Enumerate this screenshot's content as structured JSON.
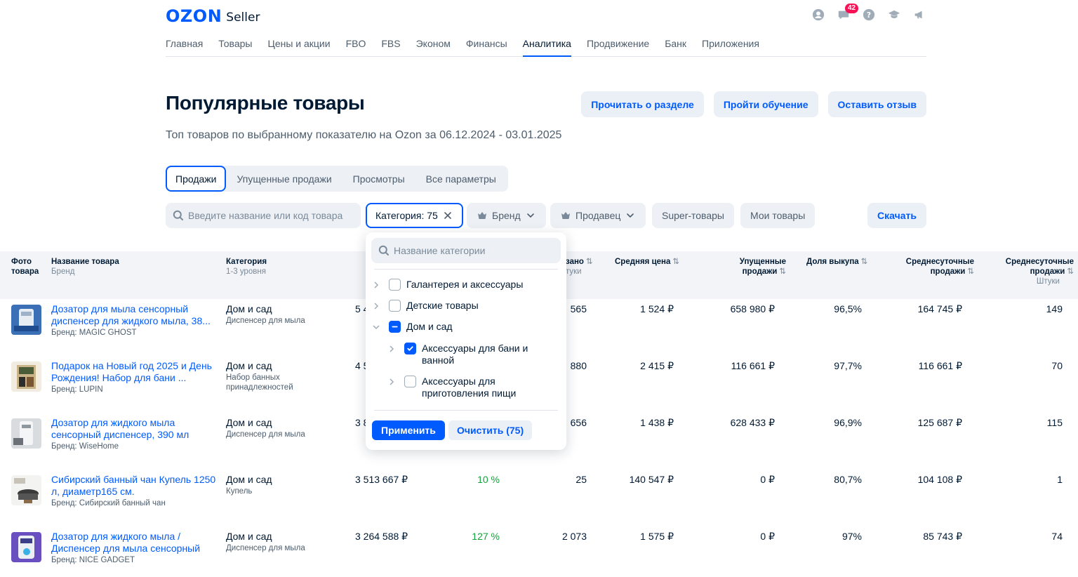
{
  "app": {
    "logo": "OZON",
    "logo_suffix": "Seller",
    "notifications_count": "42"
  },
  "top_icons": [
    "user-icon",
    "chat-icon",
    "help-icon",
    "graduation-cap-icon",
    "megaphone-icon"
  ],
  "nav": {
    "items": [
      "Главная",
      "Товары",
      "Цены и акции",
      "FBO",
      "FBS",
      "Эконом",
      "Финансы",
      "Аналитика",
      "Продвижение",
      "Банк",
      "Приложения"
    ],
    "active": "Аналитика"
  },
  "header": {
    "title": "Популярные товары",
    "subtitle": "Топ товаров по выбранному показателю на Ozon за 06.12.2024 - 03.01.2025",
    "buttons": [
      "Прочитать о разделе",
      "Пройти обучение",
      "Оставить отзыв"
    ]
  },
  "tabs": {
    "items": [
      "Продажи",
      "Упущенные продажи",
      "Просмотры",
      "Все параметры"
    ],
    "active": "Продажи"
  },
  "filters": {
    "search_placeholder": "Введите название или код товара",
    "category": "Категория: 75",
    "brand": "Бренд",
    "seller": "Продавец",
    "super": "Super-товары",
    "mine": "Мои товары",
    "download": "Скачать"
  },
  "table": {
    "headers": {
      "photo": "Фото товара",
      "name": "Название товара",
      "name_sub": "Бренд",
      "category": "Категория",
      "category_sub": "1-3 уровня",
      "ordered": "зано",
      "ordered_sub": "туки",
      "avg_price": "Средняя цена",
      "missed": "Упущенные продажи",
      "buyout": "Доля выкупа",
      "daily": "Среднесуточные продажи",
      "daily_units": "Среднесуточные продажи",
      "daily_units_sub": "Штуки"
    },
    "rows": [
      {
        "name": "Дозатор для мыла сенсорный диспенсер для жидкого мыла, 38...",
        "brand": "Бренд: MAGIC GHOST",
        "category": "Дом и сад",
        "subcategory": "Диспенсер для мыла",
        "revenue": "5 4",
        "dynamic": "",
        "units": "565",
        "avg_price": "1 524 ₽",
        "missed": "658 980 ₽",
        "buyout": "96,5%",
        "daily": "164 745 ₽",
        "daily_units": "149"
      },
      {
        "name": "Подарок на Новый год 2025 и День Рождения! Набор для бани ...",
        "brand": "Бренд: LUPIN",
        "category": "Дом и сад",
        "subcategory": "Набор банных принадлежностей",
        "revenue": "4 5",
        "dynamic": "",
        "units": "880",
        "avg_price": "2 415 ₽",
        "missed": "116 661 ₽",
        "buyout": "97,7%",
        "daily": "116 661 ₽",
        "daily_units": "70"
      },
      {
        "name": "Дозатор для жидкого мыла сенсорный диспенсер, 390 мл",
        "brand": "Бренд: WiseHome",
        "category": "Дом и сад",
        "subcategory": "Диспенсер для мыла",
        "revenue": "3 8",
        "dynamic": "",
        "units": "656",
        "avg_price": "1 438 ₽",
        "missed": "628 433 ₽",
        "buyout": "96,9%",
        "daily": "125 687 ₽",
        "daily_units": "115"
      },
      {
        "name": "Сибирский банный чан Купель 1250 л, диаметр165 см.",
        "brand": "Бренд: Сибирский банный чан",
        "category": "Дом и сад",
        "subcategory": "Купель",
        "revenue": "3 513 667 ₽",
        "dynamic": "10 %",
        "units": "25",
        "avg_price": "140 547 ₽",
        "missed": "0 ₽",
        "buyout": "80,7%",
        "daily": "104 108 ₽",
        "daily_units": "1"
      },
      {
        "name": "Дозатор для жидкого мыла / Диспенсер для мыла сенсорный",
        "brand": "Бренд: NICE GADGET",
        "category": "Дом и сад",
        "subcategory": "Диспенсер для мыла",
        "revenue": "3 264 588 ₽",
        "dynamic": "127 %",
        "units": "2 073",
        "avg_price": "1 575 ₽",
        "missed": "0 ₽",
        "buyout": "97%",
        "daily": "85 743 ₽",
        "daily_units": "74"
      }
    ]
  },
  "dropdown": {
    "search_placeholder": "Название категории",
    "items": [
      {
        "label": "Галантерея и аксессуары",
        "checked": false,
        "level": 0
      },
      {
        "label": "Детские товары",
        "checked": false,
        "level": 0
      },
      {
        "label": "Дом и сад",
        "checked": "partial",
        "level": 0
      },
      {
        "label": "Аксессуары для бани и ванной",
        "checked": true,
        "level": 1
      },
      {
        "label": "Аксессуары для приготовления пищи",
        "checked": false,
        "level": 1
      }
    ],
    "apply": "Применить",
    "clear": "Очистить (75)"
  },
  "colors": {
    "accent": "#005bff",
    "badge": "#f91155",
    "positive": "#10a43b",
    "text": "#001a34",
    "muted": "#4d5d6d"
  }
}
